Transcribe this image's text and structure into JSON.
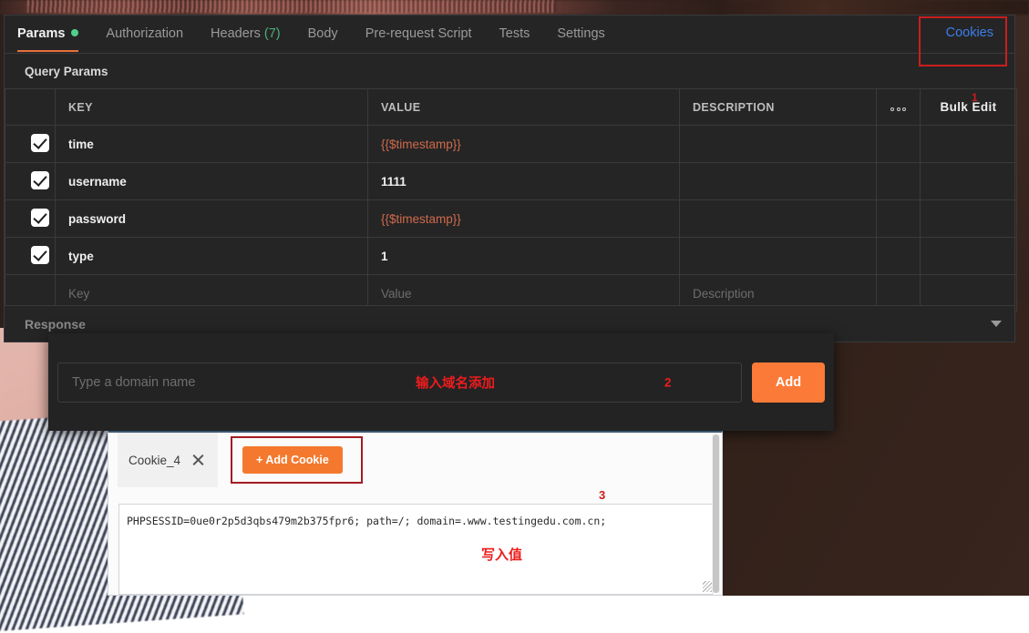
{
  "app": {
    "tabs": [
      {
        "label": "Params",
        "active": true,
        "has_dot": true,
        "count": ""
      },
      {
        "label": "Authorization",
        "active": false,
        "has_dot": false,
        "count": ""
      },
      {
        "label": "Headers",
        "active": false,
        "has_dot": false,
        "count": "(7)"
      },
      {
        "label": "Body",
        "active": false,
        "has_dot": false,
        "count": ""
      },
      {
        "label": "Pre-request Script",
        "active": false,
        "has_dot": false,
        "count": ""
      },
      {
        "label": "Tests",
        "active": false,
        "has_dot": false,
        "count": ""
      },
      {
        "label": "Settings",
        "active": false,
        "has_dot": false,
        "count": ""
      }
    ],
    "cookies_link": "Cookies",
    "section_title": "Query Params",
    "table": {
      "headers": {
        "key": "KEY",
        "value": "VALUE",
        "description": "DESCRIPTION",
        "more": "ooo",
        "bulk_edit": "Bulk Edit"
      },
      "rows": [
        {
          "checked": true,
          "key": "time",
          "value": "{{$timestamp}}",
          "value_kind": "variable",
          "description": ""
        },
        {
          "checked": true,
          "key": "username",
          "value": "1111",
          "value_kind": "plain",
          "description": ""
        },
        {
          "checked": true,
          "key": "password",
          "value": "{{$timestamp}}",
          "value_kind": "variable",
          "description": ""
        },
        {
          "checked": true,
          "key": "type",
          "value": "1",
          "value_kind": "plain",
          "description": ""
        }
      ],
      "empty_row": {
        "key_placeholder": "Key",
        "value_placeholder": "Value",
        "description_placeholder": "Description"
      }
    },
    "response_label": "Response"
  },
  "domain_modal": {
    "input_placeholder": "Type a domain name",
    "add_button": "Add"
  },
  "cookie_panel": {
    "tab_label": "Cookie_4",
    "add_cookie_button": "+ Add Cookie",
    "cookie_value": "PHPSESSID=0ue0r2p5d3qbs479m2b375fpr6; path=/; domain=.www.testingedu.com.cn;"
  },
  "annotations": {
    "marker_1": "1",
    "marker_2": "2",
    "marker_3": "3",
    "domain_note": "输入域名添加",
    "write_value_note": "写入值"
  },
  "colors": {
    "accent_orange": "#fb7a37",
    "tab_underline": "#e8713c",
    "link_blue": "#3d7dea",
    "annotation_red": "#ed1c1c",
    "box_red": "#cc1d1d",
    "variable_orange": "#cf6a4a",
    "status_dot_green": "#4fd18b",
    "headers_count_green": "#4fae77"
  }
}
